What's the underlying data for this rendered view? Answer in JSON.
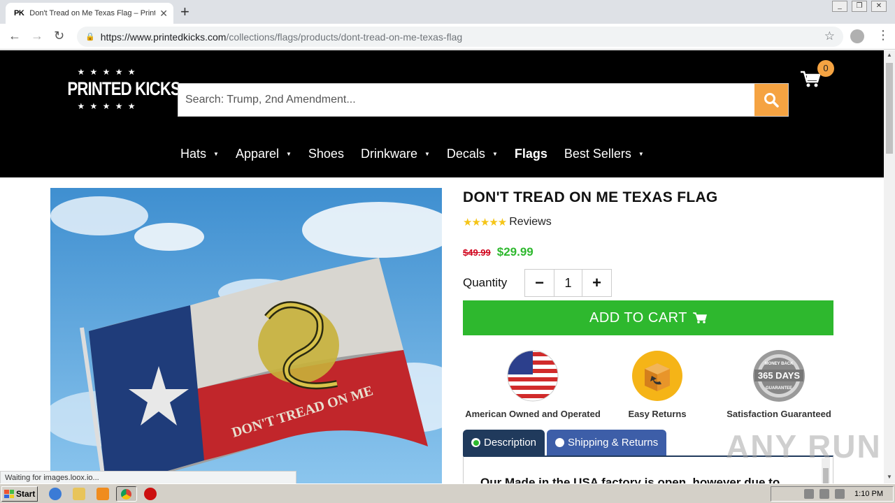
{
  "browser": {
    "tab_favicon": "PK",
    "tab_title": "Don't Tread on Me Texas Flag – Printed Kicks",
    "url_host": "https://www.printedkicks.com",
    "url_path": "/collections/flags/products/dont-tread-on-me-texas-flag",
    "status_text": "Waiting for images.loox.io..."
  },
  "site": {
    "brand": "PRINTED KICKS",
    "search_placeholder": "Search: Trump, 2nd Amendment...",
    "cart_count": "0",
    "nav": [
      {
        "label": "Hats",
        "caret": true
      },
      {
        "label": "Apparel",
        "caret": true
      },
      {
        "label": "Shoes",
        "caret": false
      },
      {
        "label": "Drinkware",
        "caret": true
      },
      {
        "label": "Decals",
        "caret": true
      },
      {
        "label": "Flags",
        "caret": false,
        "active": true
      },
      {
        "label": "Best Sellers",
        "caret": true
      }
    ]
  },
  "product": {
    "title": "DON'T TREAD ON ME TEXAS FLAG",
    "rating_stars": 5,
    "reviews_label": "Reviews",
    "old_price": "$49.99",
    "price": "$29.99",
    "quantity_label": "Quantity",
    "quantity": "1",
    "add_to_cart": "ADD TO CART",
    "flag_text": "DON'T TREAD ON ME",
    "badges": [
      {
        "label": "American Owned and Operated",
        "icon": "usa-flag-icon"
      },
      {
        "label": "Easy Returns",
        "icon": "box-return-icon"
      },
      {
        "label": "Satisfaction Guaranteed",
        "icon": "365-days-seal-icon",
        "seal_top": "MONEY BACK",
        "seal_mid": "365 DAYS",
        "seal_bot": "GUARANTEE"
      }
    ],
    "tabs": [
      {
        "label": "Description",
        "active": true
      },
      {
        "label": "Shipping & Returns",
        "active": false
      }
    ],
    "description_start": "Our Made in the USA factory is open, however due to"
  },
  "taskbar": {
    "start_label": "Start",
    "clock": "1:10 PM"
  },
  "watermark": "ANY RUN",
  "colors": {
    "header_bg": "#000000",
    "accent_orange": "#f5a342",
    "green": "#2eb82e",
    "tab_active": "#203a5c",
    "tab_inactive": "#3d5ea8",
    "old_price_red": "#d0021b"
  }
}
